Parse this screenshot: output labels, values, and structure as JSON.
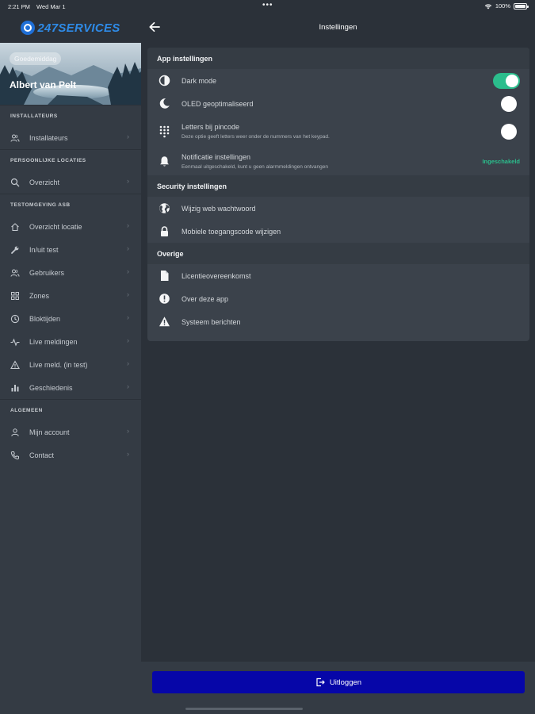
{
  "status_bar": {
    "time": "2:21 PM",
    "date": "Wed Mar 1",
    "battery": "100%",
    "dots": "•••"
  },
  "brand": {
    "logo_text": "247SERVICES"
  },
  "profile": {
    "greeting": "Goedemiddag",
    "name": "Albert van Pelt"
  },
  "sidebar": {
    "sections": [
      {
        "title": "INSTALLATEURS",
        "items": [
          {
            "label": "Installateurs",
            "icon": "users-icon"
          }
        ]
      },
      {
        "title": "PERSOONLIJKE LOCATIES",
        "items": [
          {
            "label": "Overzicht",
            "icon": "search-icon"
          }
        ]
      },
      {
        "title": "TESTOMGEVING ASB",
        "items": [
          {
            "label": "Overzicht locatie",
            "icon": "home-icon"
          },
          {
            "label": "In/uit test",
            "icon": "wrench-icon"
          },
          {
            "label": "Gebruikers",
            "icon": "users-icon"
          },
          {
            "label": "Zones",
            "icon": "grid-icon"
          },
          {
            "label": "Bloktijden",
            "icon": "clock-icon"
          },
          {
            "label": "Live meldingen",
            "icon": "pulse-icon"
          },
          {
            "label": "Live meld. (in test)",
            "icon": "warning-icon"
          },
          {
            "label": "Geschiedenis",
            "icon": "bar-chart-icon"
          }
        ]
      },
      {
        "title": "ALGEMEEN",
        "items": [
          {
            "label": "Mijn account",
            "icon": "user-icon"
          },
          {
            "label": "Contact",
            "icon": "phone-icon"
          }
        ]
      }
    ]
  },
  "header": {
    "title": "Instellingen"
  },
  "settings": {
    "app": {
      "title": "App instellingen",
      "dark_mode": {
        "label": "Dark mode",
        "enabled": true
      },
      "oled": {
        "label": "OLED geoptimaliseerd",
        "enabled": false
      },
      "letters": {
        "label": "Letters bij pincode",
        "sub": "Deze optie geeft letters weer onder de nummers van het keypad.",
        "enabled": false
      },
      "notif": {
        "label": "Notificatie instellingen",
        "sub": "Eenmaal uitgeschakeld, kunt u geen alarmmeldingen ontvangen",
        "status": "Ingeschakeld"
      }
    },
    "security": {
      "title": "Security instellingen",
      "web_password": "Wijzig web wachtwoord",
      "mobile_code": "Mobiele toegangscode wijzigen"
    },
    "other": {
      "title": "Overige",
      "license": "Licentieovereenkomst",
      "about": "Over deze app",
      "system": "Systeem berichten"
    }
  },
  "footer": {
    "logout_label": "Uitloggen"
  },
  "colors": {
    "accent_green": "#2bbd8c",
    "logout_blue": "#0606a8",
    "brand_blue": "#2e8ae6"
  }
}
